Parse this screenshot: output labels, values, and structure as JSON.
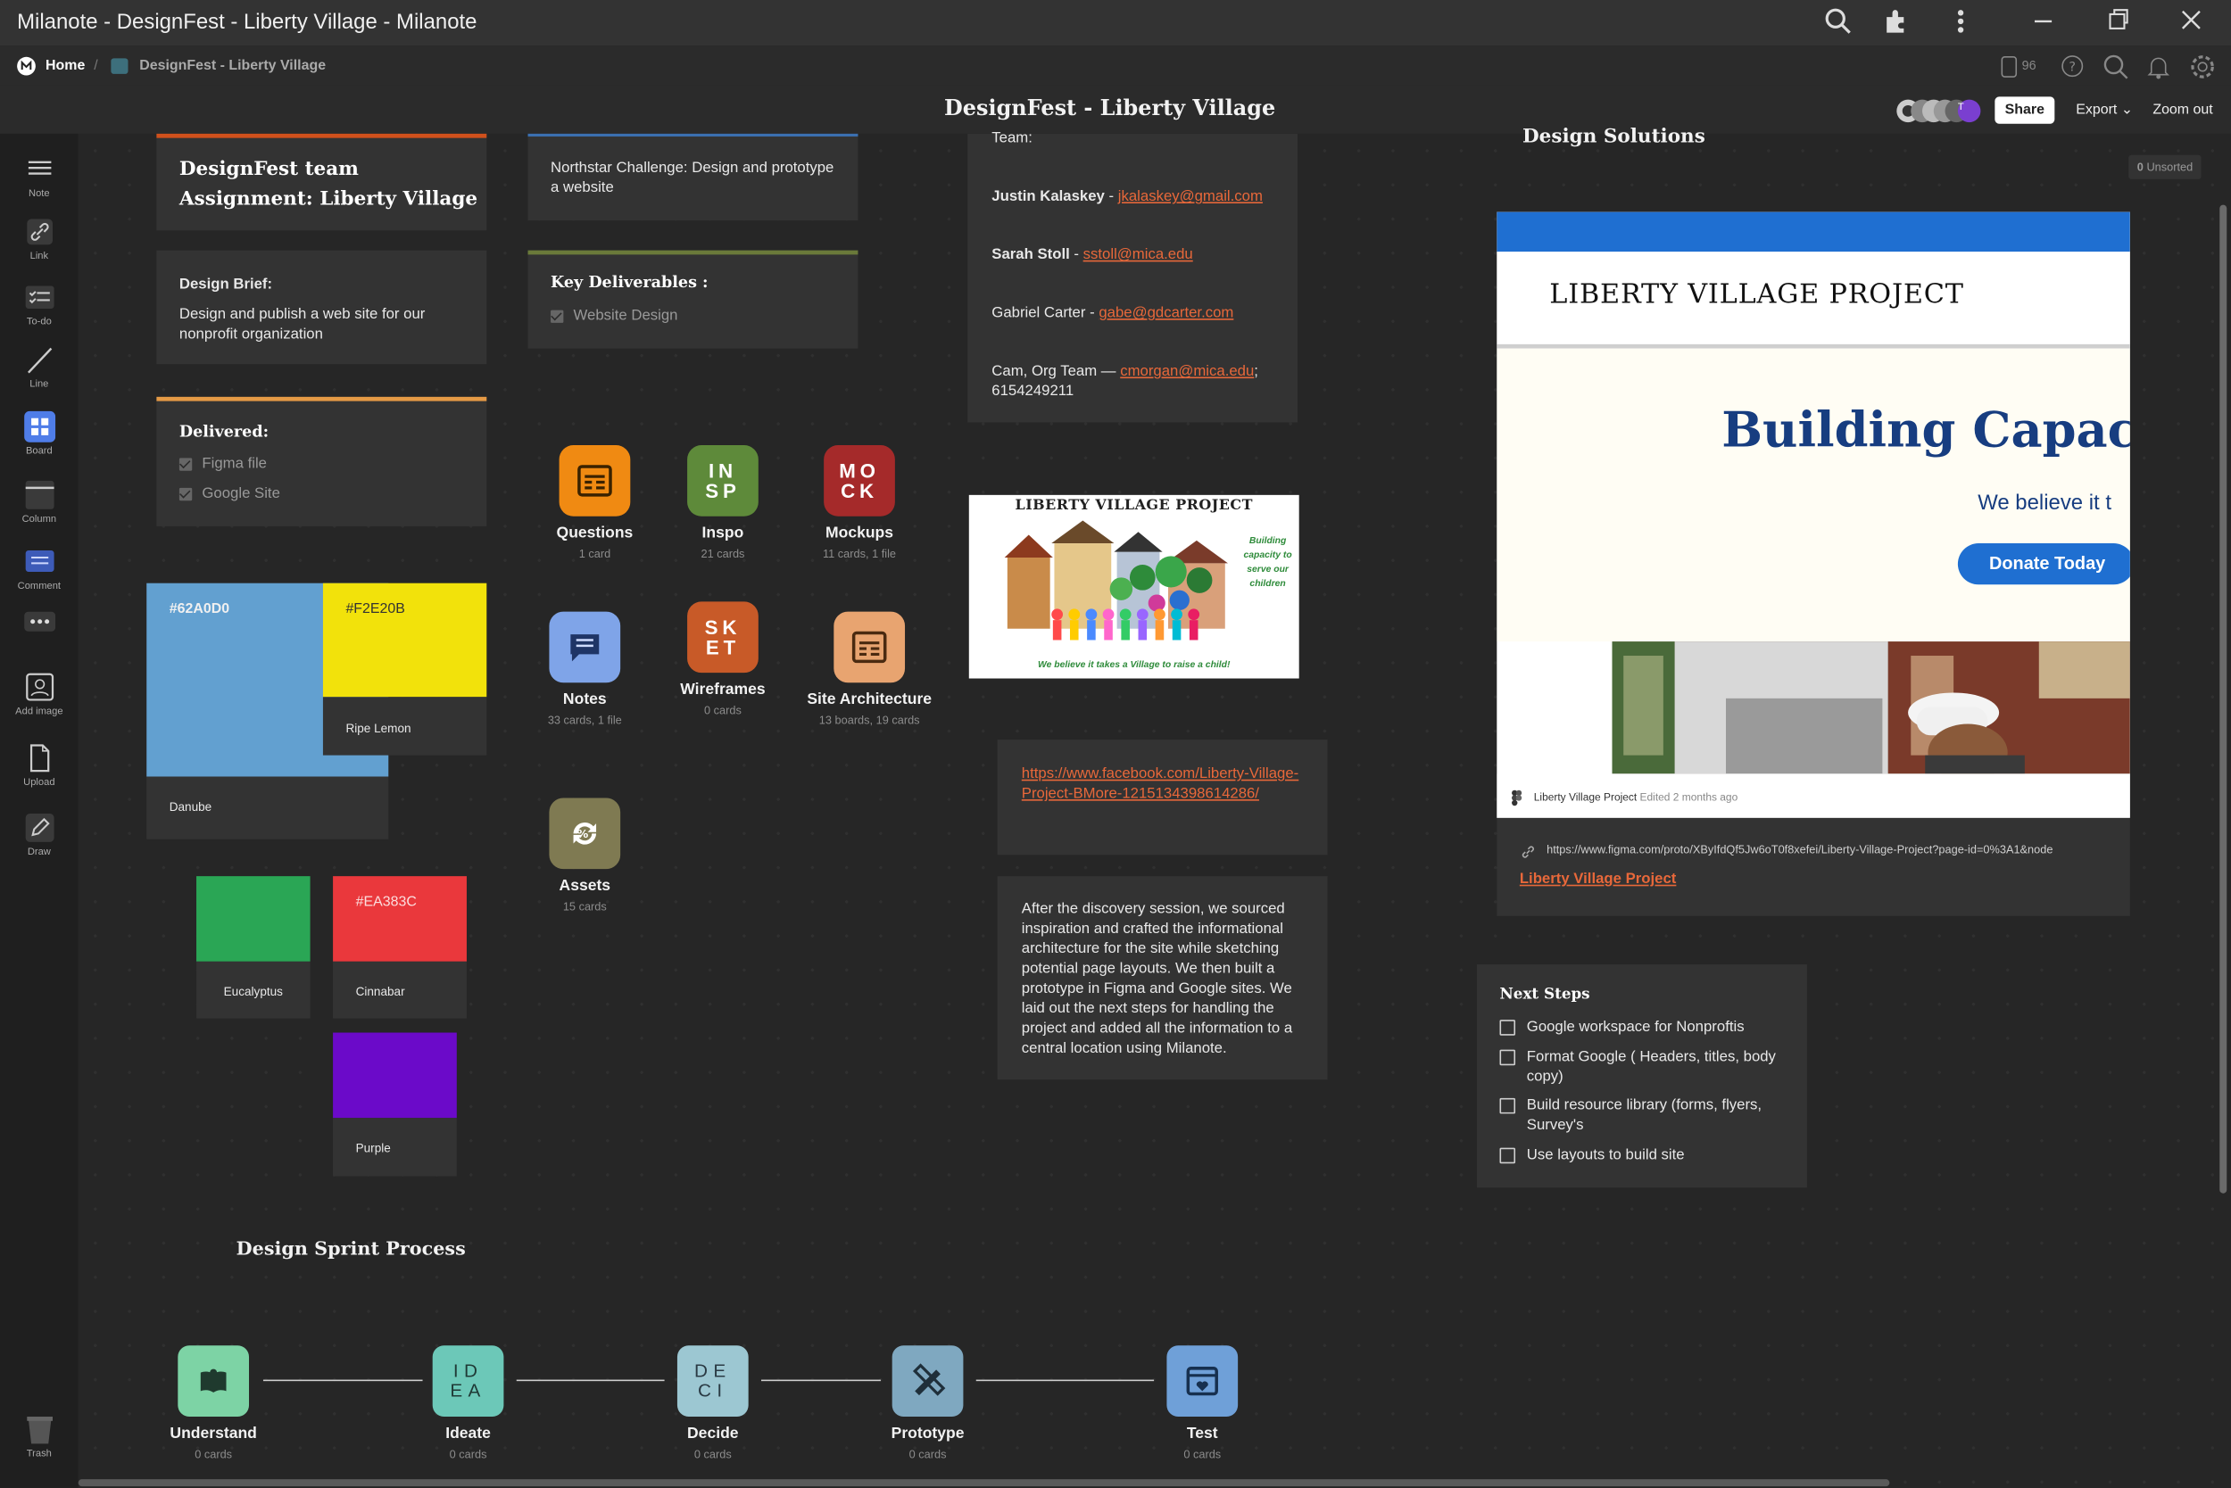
{
  "window": {
    "title": "Milanote - DesignFest - Liberty Village - Milanote"
  },
  "breadcrumb": {
    "home": "Home",
    "board": "DesignFest - Liberty Village",
    "notifications_count": "96"
  },
  "appbar": {
    "board_title": "DesignFest - Liberty Village",
    "share": "Share",
    "export": "Export",
    "zoom": "Zoom out",
    "avatar_initial": "T"
  },
  "tools": [
    "Note",
    "Link",
    "To-do",
    "Line",
    "Board",
    "Column",
    "Comment",
    "Add image",
    "Upload",
    "Draw",
    "Trash"
  ],
  "notes": {
    "assignment_title": "DesignFest team Assignment: Liberty Village",
    "brief_heading": "Design Brief:",
    "brief_body": "Design and publish a web site for our nonprofit organization",
    "delivered_heading": "Delivered:",
    "delivered_items": [
      "Figma file",
      "Google Site"
    ],
    "northstar": "Northstar Challenge:  Design and prototype a website",
    "deliverables_heading": "Key Deliverables :",
    "deliverables_items": [
      "Website Design"
    ],
    "team_heading": "Team:",
    "team": [
      {
        "name": "Justin Kalaskey",
        "sep": " - ",
        "email": "jkalaskey@gmail.com"
      },
      {
        "name": "Sarah Stoll",
        "sep": "  - ",
        "email": "sstoll@mica.edu"
      },
      {
        "name": "Gabriel Carter",
        "sep": " - ",
        "email": "gabe@gdcarter.com"
      },
      {
        "name": "Cam, Org Team",
        "sep": " — ",
        "email": "cmorgan@mica.edu",
        "extra": "; 6154249211"
      }
    ],
    "facebook_link": "https://www.facebook.com/Liberty-Village-Project-BMore-1215134398614286/",
    "summary": "After the discovery session, we sourced inspiration and crafted the informational architecture for the site while sketching potential page layouts. We then built a prototype in Figma and Google sites. We laid out the next steps for handling the project and added all the information to a central location using Milanote.",
    "next_steps_heading": "Next Steps",
    "next_steps": [
      "Google workspace for Nonproftis",
      "Format Google ( Headers, titles, body copy)",
      "Build resource library (forms, flyers, Survey's",
      "Use layouts to build site"
    ],
    "sprint_heading": "Design Sprint Process"
  },
  "swatches": [
    {
      "label": "Danube",
      "hex": "#62A0D0",
      "color": "#62A0D0"
    },
    {
      "label": "Ripe Lemon",
      "hex": "#F2E20B",
      "color": "#F2E20B"
    },
    {
      "label": "Eucalyptus",
      "hex": "",
      "color": "#2AA655"
    },
    {
      "label": "Cinnabar",
      "hex": "#EA383C",
      "color": "#EA383C"
    },
    {
      "label": "Purple",
      "hex": "",
      "color": "#6B0AC9"
    }
  ],
  "boards": [
    {
      "name": "Questions",
      "sub": "1 card",
      "color": "#F08A12",
      "glyph": ""
    },
    {
      "name": "Inspo",
      "sub": "21 cards",
      "color": "#5E8A3A",
      "glyph": "IN SP"
    },
    {
      "name": "Mockups",
      "sub": "11 cards, 1 file",
      "color": "#A52A2A",
      "glyph": "MO CK"
    },
    {
      "name": "Notes",
      "sub": "33 cards, 1 file",
      "color": "#7FA4E8",
      "glyph": ""
    },
    {
      "name": "Wireframes",
      "sub": "0 cards",
      "color": "#C85A28",
      "glyph": "SK ET"
    },
    {
      "name": "Site Architecture",
      "sub": "13 boards, 19 cards",
      "color": "#E8A470",
      "glyph": ""
    },
    {
      "name": "Assets",
      "sub": "15 cards",
      "color": "#7F7A52",
      "glyph": ""
    }
  ],
  "image_card": {
    "title": "LIBERTY VILLAGE PROJECT",
    "side_text": "Building capacity to serve our children",
    "caption": "We believe it takes a Village to raise a child!"
  },
  "solutions": {
    "heading": "Design Solutions",
    "unsorted_count": "0",
    "unsorted_label": "Unsorted",
    "preview_header": "LIBERTY VILLAGE PROJECT",
    "preview_headline": "Building Capacity",
    "preview_sub": "We believe it t",
    "preview_button": "Donate Today",
    "meta_name": "Liberty Village Project",
    "meta_edited": "Edited 2 months ago",
    "url": "https://www.figma.com/proto/XByIfdQf5Jw6oT0f8xefei/Liberty-Village-Project?page-id=0%3A1&node",
    "link_title": "Liberty Village Project"
  },
  "sprint": [
    {
      "name": "Understand",
      "sub": "0 cards",
      "color": "#7DD3A5",
      "glyph": ""
    },
    {
      "name": "Ideate",
      "sub": "0 cards",
      "color": "#6CC8B8",
      "glyph": "ID EA"
    },
    {
      "name": "Decide",
      "sub": "0 cards",
      "color": "#9CC7D2",
      "glyph": "DE CI"
    },
    {
      "name": "Prototype",
      "sub": "0 cards",
      "color": "#7FA8C0",
      "glyph": ""
    },
    {
      "name": "Test",
      "sub": "0 cards",
      "color": "#6FA0D8",
      "glyph": ""
    }
  ]
}
